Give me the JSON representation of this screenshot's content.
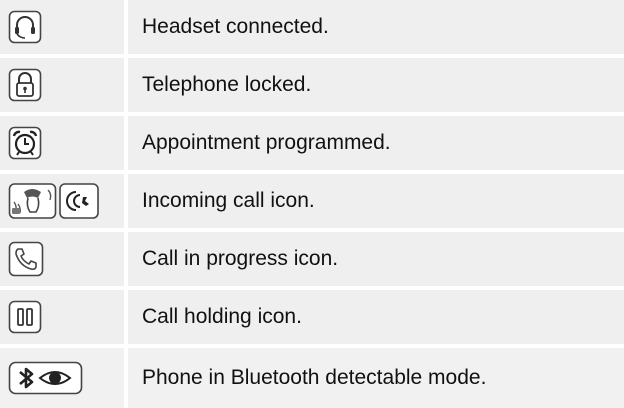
{
  "legend": {
    "rows": [
      {
        "icon": "headset-icon",
        "text": "Headset connected."
      },
      {
        "icon": "padlock-icon",
        "text": "Telephone locked."
      },
      {
        "icon": "alarm-clock-icon",
        "text": "Appointment programmed."
      },
      {
        "icon": "incoming-call-icon",
        "text": "Incoming call icon."
      },
      {
        "icon": "phone-handset-icon",
        "text": "Call in progress icon."
      },
      {
        "icon": "pause-icon",
        "text": "Call holding icon."
      },
      {
        "icon": "bluetooth-eye-icon",
        "text": "Phone in Bluetooth detectable mode."
      }
    ]
  }
}
